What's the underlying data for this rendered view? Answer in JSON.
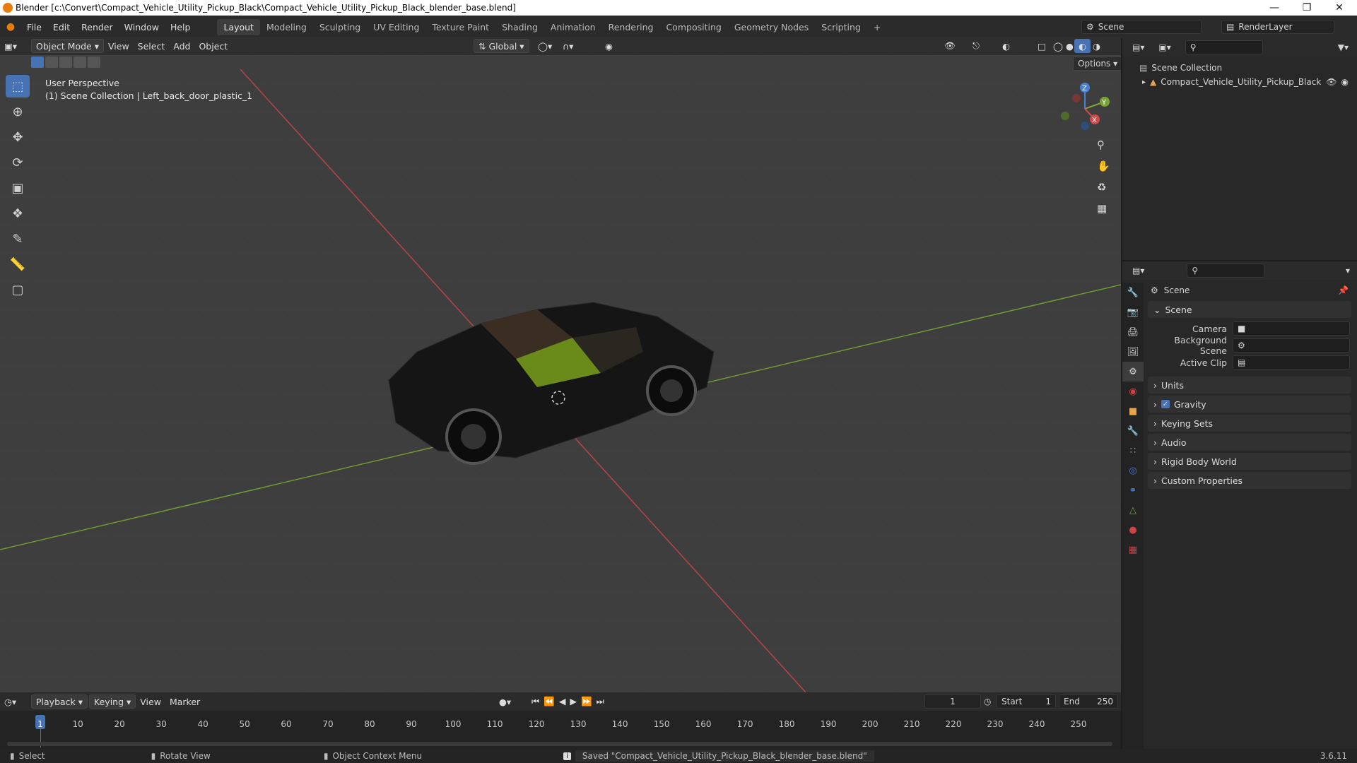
{
  "window": {
    "title": "Blender [c:\\Convert\\Compact_Vehicle_Utility_Pickup_Black\\Compact_Vehicle_Utility_Pickup_Black_blender_base.blend]"
  },
  "menus": [
    "File",
    "Edit",
    "Render",
    "Window",
    "Help"
  ],
  "workspaces": [
    "Layout",
    "Modeling",
    "Sculpting",
    "UV Editing",
    "Texture Paint",
    "Shading",
    "Animation",
    "Rendering",
    "Compositing",
    "Geometry Nodes",
    "Scripting"
  ],
  "active_workspace": "Layout",
  "scene_field": "Scene",
  "renderlayer_field": "RenderLayer",
  "header3d": {
    "mode": "Object Mode",
    "view": "View",
    "select": "Select",
    "add": "Add",
    "object": "Object",
    "orientation": "Global",
    "options": "Options"
  },
  "viewport": {
    "line1": "User Perspective",
    "line2": "(1) Scene Collection | Left_back_door_plastic_1"
  },
  "gizmo": {
    "x": "X",
    "y": "Y",
    "z": "Z"
  },
  "outliner": {
    "root": "Scene Collection",
    "item": "Compact_Vehicle_Utility_Pickup_Black"
  },
  "properties": {
    "title": "Scene",
    "section": "Scene",
    "fields": [
      {
        "label": "Camera"
      },
      {
        "label": "Background Scene"
      },
      {
        "label": "Active Clip"
      }
    ],
    "panels": [
      "Units",
      "Gravity",
      "Keying Sets",
      "Audio",
      "Rigid Body World",
      "Custom Properties"
    ]
  },
  "timeline": {
    "playback": "Playback",
    "keying": "Keying",
    "view": "View",
    "marker": "Marker",
    "current_frame": "1",
    "start_label": "Start",
    "start": "1",
    "end_label": "End",
    "end": "250",
    "ticks": [
      "1",
      "10",
      "20",
      "30",
      "40",
      "50",
      "60",
      "70",
      "80",
      "90",
      "100",
      "110",
      "120",
      "130",
      "140",
      "150",
      "160",
      "170",
      "180",
      "190",
      "200",
      "210",
      "220",
      "230",
      "240",
      "250"
    ]
  },
  "status": {
    "select": "Select",
    "rotate": "Rotate View",
    "context": "Object Context Menu",
    "message": "Saved \"Compact_Vehicle_Utility_Pickup_Black_blender_base.blend\"",
    "version": "3.6.11"
  },
  "colors": {
    "accent": "#4772b3",
    "x_axis": "#d44a4a",
    "y_axis": "#7aa33a",
    "z_axis": "#4a80d4"
  }
}
